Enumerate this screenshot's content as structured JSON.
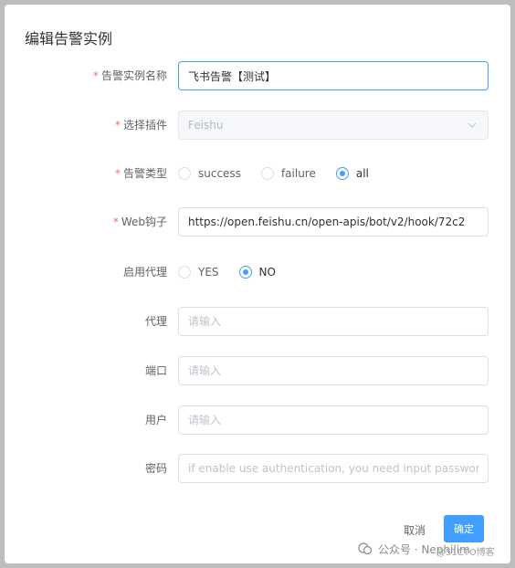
{
  "dialog": {
    "title": "编辑告警实例"
  },
  "form": {
    "name": {
      "label": "告警实例名称",
      "required": true,
      "value": "飞书告警【测试】"
    },
    "plugin": {
      "label": "选择插件",
      "required": true,
      "value": "Feishu"
    },
    "alert_type": {
      "label": "告警类型",
      "required": true,
      "options": [
        "success",
        "failure",
        "all"
      ],
      "selected": "all"
    },
    "webhook": {
      "label": "Web钩子",
      "required": true,
      "value": "https://open.feishu.cn/open-apis/bot/v2/hook/72c2"
    },
    "proxy_enabled": {
      "label": "启用代理",
      "options": [
        "YES",
        "NO"
      ],
      "selected": "NO"
    },
    "proxy": {
      "label": "代理",
      "placeholder": "请输入"
    },
    "port": {
      "label": "端口",
      "placeholder": "请输入"
    },
    "user": {
      "label": "用户",
      "placeholder": "请输入"
    },
    "password": {
      "label": "密码",
      "placeholder": "if enable use authentication, you need input password"
    }
  },
  "footer": {
    "cancel_label": "取消",
    "ok_label": "确定"
  },
  "watermark": {
    "left_text": "公众号 · Nephilim",
    "right_text": "@51CTO博客"
  },
  "colors": {
    "primary": "#409eff",
    "required": "#f56c6c",
    "overlay": "#bdbdbd"
  }
}
